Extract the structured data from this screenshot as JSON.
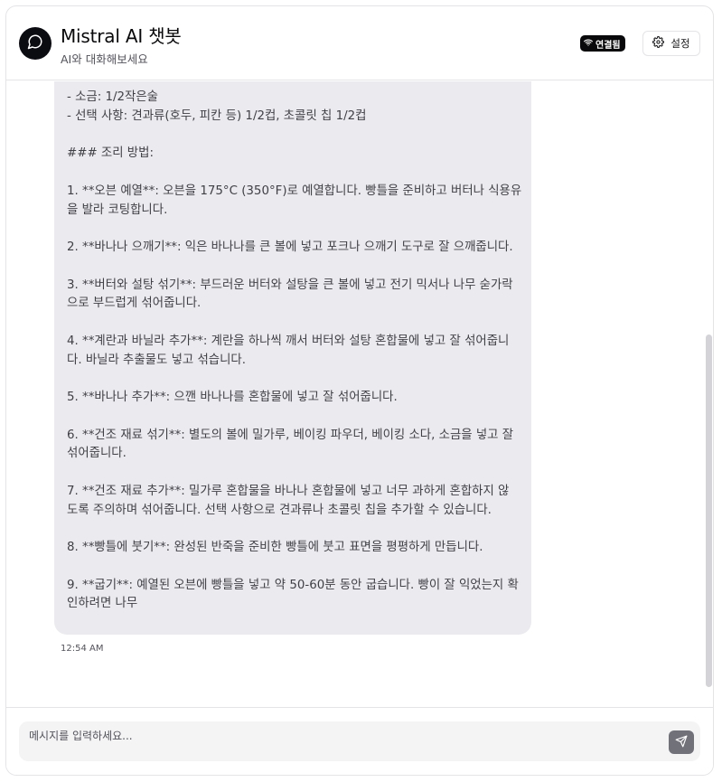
{
  "header": {
    "title": "Mistral AI 챗봇",
    "subtitle": "AI와 대화해보세요",
    "status_badge": "연결됨",
    "settings_label": "설정"
  },
  "message": {
    "lines": [
      "- 소금: 1/2작은술",
      "- 선택 사항: 견과류(호두, 피칸 등) 1/2컵, 초콜릿 칩 1/2컵",
      "",
      "### 조리 방법:",
      "",
      "1. **오븐 예열**: 오븐을 175°C (350°F)로 예열합니다. 빵틀을 준비하고 버터나 식용유",
      "을 발라 코팅합니다.",
      "",
      "2. **바나나 으깨기**: 익은 바나나를 큰 볼에 넣고 포크나 으깨기 도구로 잘 으깨줍니다.",
      "",
      "3. **버터와 설탕 섞기**: 부드러운 버터와 설탕을 큰 볼에 넣고 전기 믹서나 나무 숟가락",
      "으로 부드럽게 섞어줍니다.",
      "",
      "4. **계란과 바닐라 추가**: 계란을 하나씩 깨서 버터와 설탕 혼합물에 넣고 잘 섞어줍니",
      "다. 바닐라 추출물도 넣고 섞습니다.",
      "",
      "5. **바나나 추가**: 으깬 바나나를 혼합물에 넣고 잘 섞어줍니다.",
      "",
      "6. **건조 재료 섞기**: 별도의 볼에 밀가루, 베이킹 파우더, 베이킹 소다, 소금을 넣고 잘",
      "섞어줍니다.",
      "",
      "7. **건조 재료 추가**: 밀가루 혼합물을 바나나 혼합물에 넣고 너무 과하게 혼합하지 않",
      "도록 주의하며 섞어줍니다. 선택 사항으로 견과류나 초콜릿 칩을 추가할 수 있습니다.",
      "",
      "8. **빵틀에 붓기**: 완성된 반죽을 준비한 빵틀에 붓고 표면을 평평하게 만듭니다.",
      "",
      "9. **굽기**: 예열된 오븐에 빵틀을 넣고 약 50-60분 동안 굽습니다. 빵이 잘 익었는지 확",
      "인하려면 나무"
    ],
    "timestamp": "12:54 AM"
  },
  "composer": {
    "placeholder": "메시지를 입력하세요...",
    "value": ""
  },
  "icons": {
    "avatar": "message-circle-icon",
    "status": "wifi-icon",
    "settings": "gear-icon",
    "send": "send-icon"
  },
  "colors": {
    "primary": "#09090b",
    "bubble": "#ebebef",
    "send_button": "#71717a"
  }
}
